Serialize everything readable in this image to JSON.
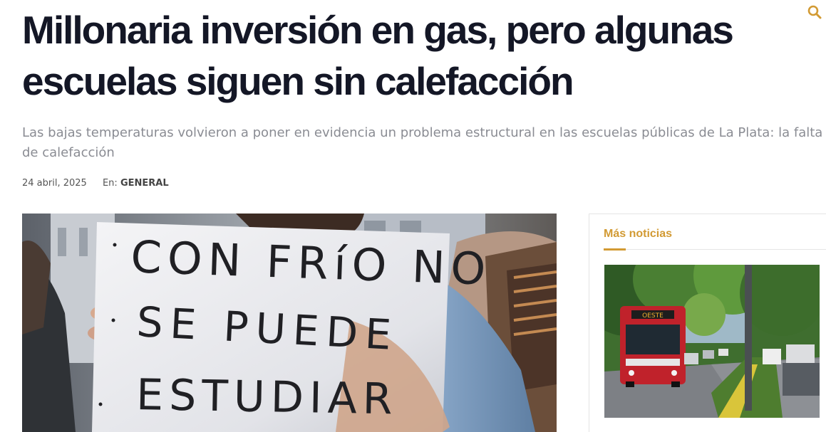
{
  "header": {
    "search_icon": "search-icon",
    "accent_color": "#d29a33"
  },
  "article": {
    "title_line1": "Millonaria inversión en gas, pero algunas",
    "title_line2": "escuelas siguen sin calefacción",
    "subtitle": "Las bajas temperaturas volvieron a poner en evidencia un problema estructural en las escuelas públicas de La Plata: la falta de calefacción",
    "date": "24 abril, 2025",
    "category_prefix": "En:",
    "category": "GENERAL",
    "image": {
      "sign_line1": "CON FRíO NO",
      "sign_line2": "SE PUEDE",
      "sign_line3": "ESTUDIAR"
    }
  },
  "sidebar": {
    "title": "Más noticias",
    "items": [
      {
        "bus_sign": "OESTE"
      }
    ]
  }
}
